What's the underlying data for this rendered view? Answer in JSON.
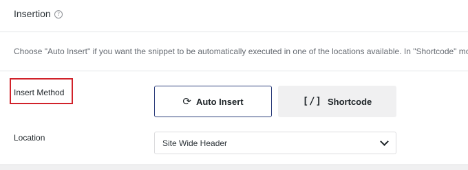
{
  "section": {
    "title": "Insertion",
    "help_icon": "question-circle-icon",
    "description": "Choose \"Auto Insert\" if you want the snippet to be automatically executed in one of the locations available. In \"Shortcode\" mode,"
  },
  "insert_method": {
    "label": "Insert Method",
    "highlight_color": "#d1222a",
    "options": [
      {
        "label": "Auto Insert",
        "icon": "refresh-icon",
        "glyph": "⟳",
        "selected": true
      },
      {
        "label": "Shortcode",
        "icon": "shortcode-brackets-icon",
        "glyph": "[/]",
        "selected": false
      }
    ]
  },
  "location": {
    "label": "Location",
    "selected": "Site Wide Header",
    "icon": "chevron-down-icon"
  }
}
